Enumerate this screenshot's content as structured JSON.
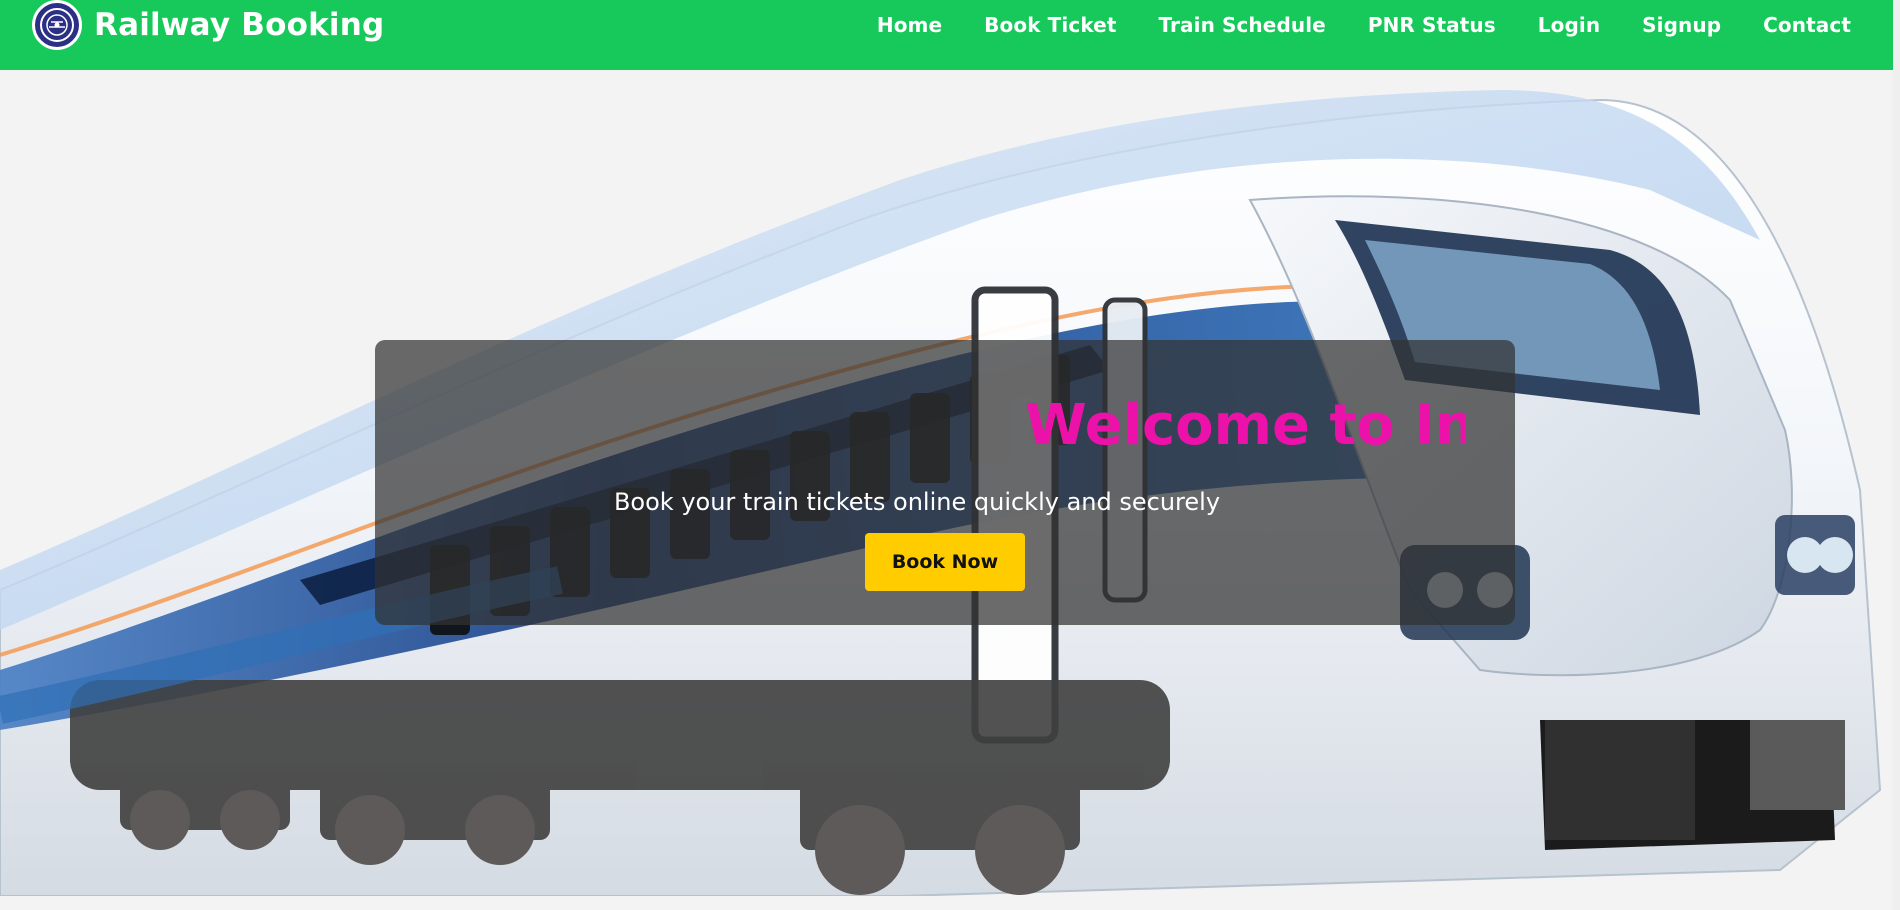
{
  "header": {
    "brand": "Railway Booking",
    "logo_icon": "indian-railways-emblem-icon",
    "nav": [
      {
        "id": "home",
        "label": "Home"
      },
      {
        "id": "book-ticket",
        "label": "Book Ticket"
      },
      {
        "id": "train-schedule",
        "label": "Train Schedule"
      },
      {
        "id": "pnr-status",
        "label": "PNR Status"
      },
      {
        "id": "login",
        "label": "Login"
      },
      {
        "id": "signup",
        "label": "Signup"
      },
      {
        "id": "contact",
        "label": "Contact"
      }
    ]
  },
  "hero": {
    "marquee_text": "Welcome to India",
    "subtitle": "Book your train tickets online quickly and securely",
    "cta_label": "Book Now",
    "background_icon": "train-hero-image"
  },
  "colors": {
    "header_bg": "#16c95a",
    "marquee_text": "#ec12a9",
    "cta_bg": "#ffcc00",
    "overlay_bg": "rgba(50,50,50,0.72)"
  }
}
